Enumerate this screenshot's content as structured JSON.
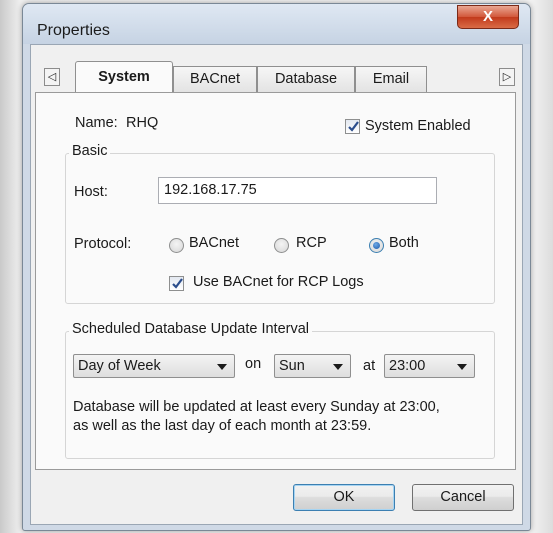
{
  "window": {
    "title": "Properties",
    "close_glyph": "X"
  },
  "tabs": {
    "scroll_left": "◁",
    "scroll_right": "▷",
    "items": [
      {
        "label": "System"
      },
      {
        "label": "BACnet"
      },
      {
        "label": "Database"
      },
      {
        "label": "Email"
      }
    ],
    "active": "System"
  },
  "system": {
    "name_label": "Name:",
    "name_value": "RHQ",
    "system_enabled_label": "System Enabled",
    "system_enabled_checked": true
  },
  "basic": {
    "group_title": "Basic",
    "host_label": "Host:",
    "host_value": "192.168.17.75",
    "protocol_label": "Protocol:",
    "protocol_options": [
      "BACnet",
      "RCP",
      "Both"
    ],
    "protocol_selected": "Both",
    "use_bacnet_label": "Use BACnet for RCP Logs",
    "use_bacnet_checked": true
  },
  "schedule": {
    "group_title": "Scheduled Database Update Interval",
    "interval_value": "Day of Week",
    "on_label": "on",
    "day_value": "Sun",
    "at_label": "at",
    "time_value": "23:00",
    "description_line1": "Database will be updated at least every Sunday at 23:00,",
    "description_line2": "as well as the last day of each month at 23:59."
  },
  "buttons": {
    "ok": "OK",
    "cancel": "Cancel"
  },
  "colors": {
    "accent": "#1c58a8",
    "close": "#c23a1c"
  }
}
